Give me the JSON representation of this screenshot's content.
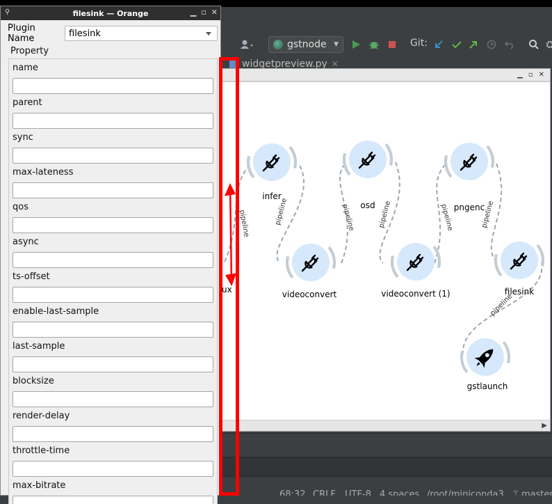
{
  "property_window": {
    "title": "filesink — Orange",
    "plugin_name_label": "Plugin Name",
    "plugin_name_value": "filesink",
    "property_heading": "Property",
    "properties": [
      {
        "label": "name",
        "value": ""
      },
      {
        "label": "parent",
        "value": ""
      },
      {
        "label": "sync",
        "value": ""
      },
      {
        "label": "max-lateness",
        "value": ""
      },
      {
        "label": "qos",
        "value": ""
      },
      {
        "label": "async",
        "value": ""
      },
      {
        "label": "ts-offset",
        "value": ""
      },
      {
        "label": "enable-last-sample",
        "value": ""
      },
      {
        "label": "last-sample",
        "value": ""
      },
      {
        "label": "blocksize",
        "value": ""
      },
      {
        "label": "render-delay",
        "value": ""
      },
      {
        "label": "throttle-time",
        "value": ""
      },
      {
        "label": "max-bitrate",
        "value": ""
      }
    ]
  },
  "ide": {
    "run_config": "gstnode",
    "git_label": "Git:",
    "editor_tab": "widgetpreview.py",
    "status": {
      "position": "68:32",
      "line_sep": "CRLF",
      "encoding": "UTF-8",
      "indent": "4 spaces",
      "interpreter": "/root/miniconda3",
      "branch": "master"
    }
  },
  "canvas": {
    "nodes": [
      {
        "id": "infer",
        "label": "infer",
        "icon": "plug-icon"
      },
      {
        "id": "osd",
        "label": "osd",
        "icon": "plug-icon"
      },
      {
        "id": "pngenc",
        "label": "pngenc",
        "icon": "plug-icon"
      },
      {
        "id": "videoconvert",
        "label": "videoconvert",
        "icon": "plug-icon"
      },
      {
        "id": "videoconvert1",
        "label": "videoconvert (1)",
        "icon": "plug-icon"
      },
      {
        "id": "filesink",
        "label": "filesink",
        "icon": "plug-icon"
      },
      {
        "id": "gstlaunch",
        "label": "gstlaunch",
        "icon": "rocket-icon"
      },
      {
        "id": "mux",
        "label": "ux",
        "icon": ""
      }
    ],
    "link_label": "pipeline"
  },
  "colors": {
    "annotation_red": "#ff0000",
    "node_fill": "#d6e8fb",
    "node_ring": "#9aa7b3",
    "link": "#9aa7b3",
    "ide_bg": "#3c3f41",
    "run_green": "#499c54",
    "debug_green": "#59a869",
    "stop_red": "#c75450",
    "git_blue": "#3592c4",
    "git_green": "#62b543"
  }
}
